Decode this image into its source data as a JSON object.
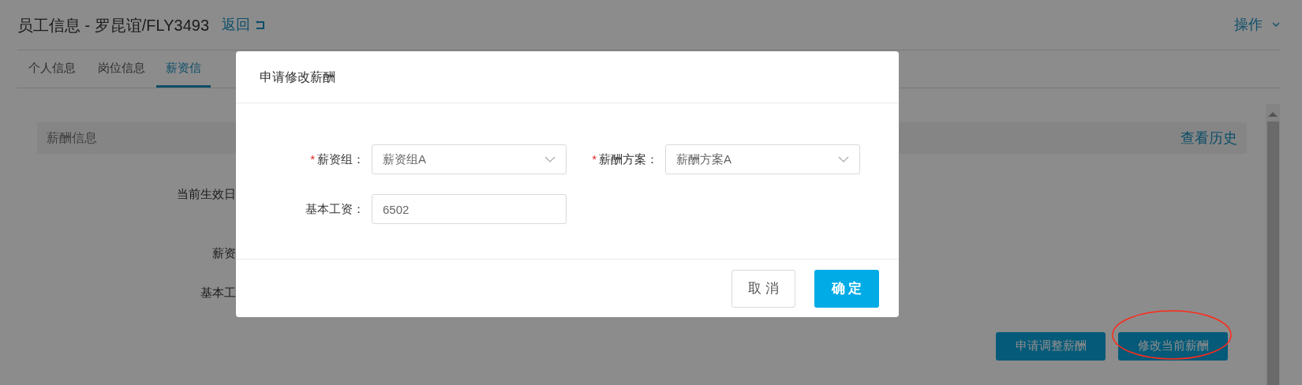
{
  "header": {
    "title": "员工信息 - 罗昆谊/FLY3493",
    "back_link": "返回",
    "actions_menu": "操作"
  },
  "tabs": [
    {
      "label": "个人信息",
      "selected": false
    },
    {
      "label": "岗位信息",
      "selected": false
    },
    {
      "label": "薪资信",
      "selected": true
    }
  ],
  "panel": {
    "title": "薪酬信息",
    "history_link": "查看历史",
    "fields": [
      {
        "label": "当前生效日"
      },
      {
        "label": "薪资"
      },
      {
        "label": "基本工"
      }
    ],
    "buttons": [
      "申请调整薪酬",
      "修改当前薪酬"
    ]
  },
  "dialog": {
    "title": "申请修改薪酬",
    "required_mark": "*",
    "fields": [
      {
        "kind": "select",
        "label": "薪资组：",
        "required": true,
        "value": "薪资组A"
      },
      {
        "kind": "select",
        "label": "薪酬方案：",
        "required": true,
        "value": "薪酬方案A"
      },
      {
        "kind": "input",
        "label": "基本工资：",
        "required": false,
        "value": "6502"
      }
    ],
    "buttons": [
      {
        "label": "取 消",
        "kind": "default"
      },
      {
        "label": "确 定",
        "kind": "primary"
      }
    ]
  }
}
